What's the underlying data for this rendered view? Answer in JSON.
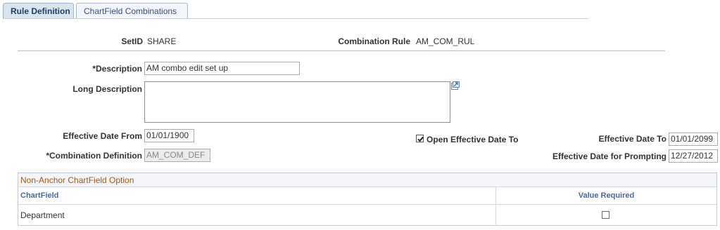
{
  "tabs": [
    {
      "label": "Rule Definition",
      "active": true
    },
    {
      "label": "ChartField Combinations",
      "active": false
    }
  ],
  "header": {
    "setid_label": "SetID",
    "setid_value": "SHARE",
    "combination_rule_label": "Combination Rule",
    "combination_rule_value": "AM_COM_RUL"
  },
  "form": {
    "description_label": "*Description",
    "description_value": "AM combo edit set up",
    "long_description_label": "Long Description",
    "long_description_value": "",
    "effective_date_from_label": "Effective Date From",
    "effective_date_from_value": "01/01/1900",
    "open_effective_date_to_label": "Open Effective Date To",
    "open_effective_date_to_checked": true,
    "effective_date_to_label": "Effective Date To",
    "effective_date_to_value": "01/01/2099",
    "combination_definition_label": "*Combination Definition",
    "combination_definition_value": "AM_COM_DEF",
    "effective_date_prompting_label": "Effective Date for Prompting",
    "effective_date_prompting_value": "12/27/2012"
  },
  "grid": {
    "title": "Non-Anchor ChartField Option",
    "columns": [
      "ChartField",
      "Value Required"
    ],
    "rows": [
      {
        "chartfield": "Department",
        "value_required": false
      }
    ]
  },
  "colors": {
    "grid_title": "#9b5a1a",
    "column_header": "#4b6a91",
    "active_tab_bg": "#d9e4ef"
  },
  "icons": {
    "long_description_expand": "expand-window-icon",
    "open_date_checkbox": "checkbox-checked-icon",
    "value_required_checkbox": "checkbox-unchecked-icon"
  }
}
